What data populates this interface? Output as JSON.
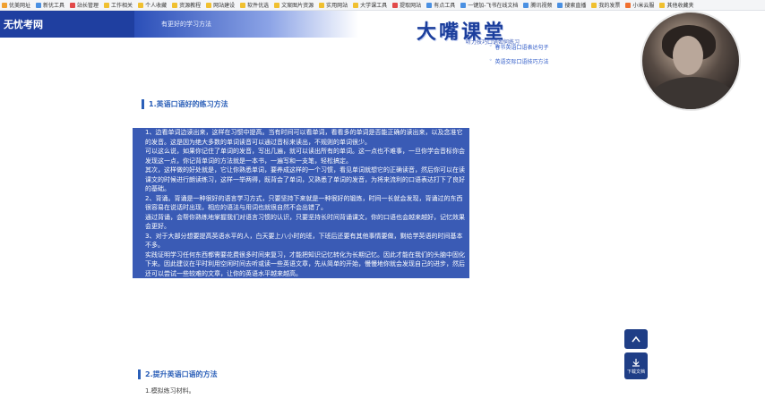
{
  "bookmarks": [
    {
      "label": "优美网址",
      "color": "#f0a030"
    },
    {
      "label": "新优工具",
      "color": "#4a90e2"
    },
    {
      "label": "站长管理",
      "color": "#e24a4a"
    },
    {
      "label": "工作相关",
      "color": "#f0c030"
    },
    {
      "label": "个人收藏",
      "color": "#f0c030"
    },
    {
      "label": "资源教程",
      "color": "#f0c030"
    },
    {
      "label": "网站建设",
      "color": "#f0c030"
    },
    {
      "label": "软件优选",
      "color": "#f0c030"
    },
    {
      "label": "文案图片资源",
      "color": "#f0c030"
    },
    {
      "label": "实用网站",
      "color": "#f0c030"
    },
    {
      "label": "大学课工具",
      "color": "#f0c030"
    },
    {
      "label": "提取网站",
      "color": "#e24a4a"
    },
    {
      "label": "有点工具",
      "color": "#4a90e2"
    },
    {
      "label": "一键加-飞书在线文档",
      "color": "#4a90e2"
    },
    {
      "label": "腾讯视频",
      "color": "#4a90e2"
    },
    {
      "label": "搜索直播",
      "color": "#4a90e2"
    },
    {
      "label": "我的发票",
      "color": "#f0c030"
    },
    {
      "label": "小米云服",
      "color": "#f07030"
    },
    {
      "label": "其他收藏夹",
      "color": "#f0c030"
    }
  ],
  "header": {
    "logo": "无忧考网",
    "logo_tail": "有更好的学习方法",
    "brand_title": "大嘴课堂",
    "brand_caption": "听力技巧口语如何练习",
    "side_links": [
      "春节英语口语表达句子",
      "英语交际口语技巧方法"
    ],
    "accent": "#1b3e9c"
  },
  "article": {
    "section1_title": "1.英语口语好的练习方法",
    "paragraphs": [
      "1、边看单词边读出来，这样在习惯中提高。当有时间可以看单词，看看多的单词是否能正确的读出来，以及念准它的发音。这是因为绝大多数的单词读音可以通过音标来读出，不规则的单词很少。",
      "可以这么说，如果你记住了单词的发音，写出几遍，就可以读出所有的单词。这一点也不难事，一旦你学会音标你会发现这一点，你记背单词的方法就是一本书，一遍写和一支笔，轻松搞定。",
      "其次，这样做的好处就是，它让你熟悉单词，要养成这样的一个习惯，看见单词就想它的正确读音，然后你可以在读课文的时候进行朗读练习，这样一举两得，既背会了单词，又熟悉了单词的发音，为将来流利的口语表达打下了良好的基础。",
      "2、背诵。背诵是一种很好的语言学习方式，只要坚持下来就是一种很好的锻炼，时间一长就会发现，背诵过的东西很容易在说话时出现，相应的语法与用词也就很自然不会出错了。",
      "通过背诵，会帮你熟练地掌握我们对语言习惯的认识，只要坚持长时间背诵课文，你的口语也会越来越好，记忆效果会更好。",
      "3、对于大部分想要提高英语水平的人，白天要上八小时的班，下班后还要有其他事情要做，剩给学英语的时间基本不多。",
      "实践证明学习任何东西都需要花费很多时间来复习，才能把知识记忆转化为长期记忆。因此才能在我们的头脑中固化下来。因此建议在平时利用空闲时间去听或读一些英语文章，先从简单的开始，慢慢地你就会发现自己的进步，然后还可以尝试一些较难的文章，让你的英语水平越来越高。"
    ],
    "section2_title": "2.提升英语口语的方法",
    "section2_first": "1.模拟练习材料。"
  },
  "tools": {
    "download_label": "下载文档"
  }
}
